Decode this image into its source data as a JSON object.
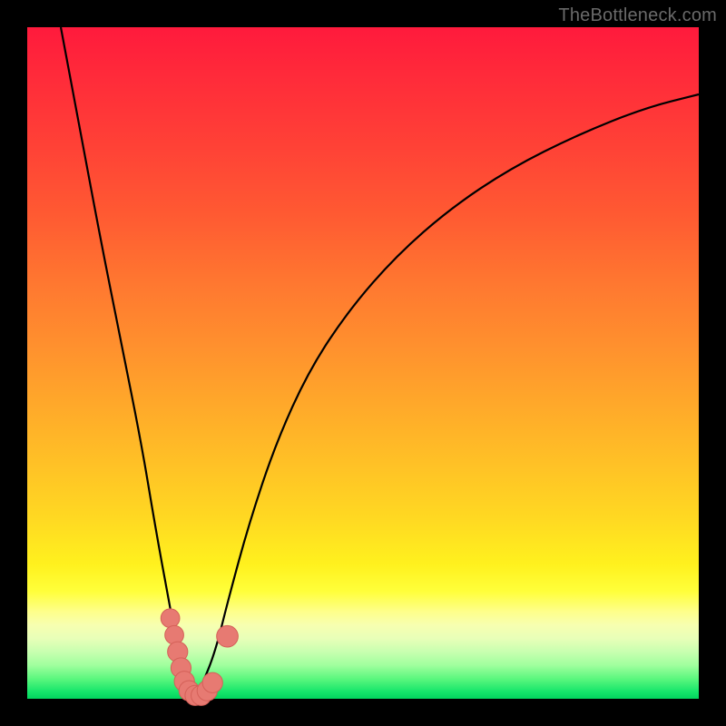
{
  "watermark": "TheBottleneck.com",
  "chart_data": {
    "type": "line",
    "title": "",
    "xlabel": "",
    "ylabel": "",
    "xlim": [
      0,
      100
    ],
    "ylim": [
      0,
      100
    ],
    "grid": false,
    "legend": false,
    "series": [
      {
        "name": "bottleneck-curve",
        "x": [
          5,
          8,
          11,
          14,
          17,
          19,
          21,
          22.5,
          24,
          25,
          26,
          28,
          30,
          33,
          37,
          42,
          48,
          55,
          63,
          72,
          82,
          92,
          100
        ],
        "y": [
          100,
          84,
          68,
          53,
          38,
          26,
          15,
          7,
          2,
          0,
          2,
          7,
          15,
          26,
          38,
          49,
          58,
          66,
          73,
          79,
          84,
          88,
          90
        ]
      }
    ],
    "markers": [
      {
        "x": 21.3,
        "y": 12.0,
        "r": 1.4
      },
      {
        "x": 21.9,
        "y": 9.5,
        "r": 1.4
      },
      {
        "x": 22.4,
        "y": 7.0,
        "r": 1.5
      },
      {
        "x": 22.9,
        "y": 4.6,
        "r": 1.5
      },
      {
        "x": 23.4,
        "y": 2.6,
        "r": 1.5
      },
      {
        "x": 24.1,
        "y": 1.2,
        "r": 1.5
      },
      {
        "x": 25.0,
        "y": 0.5,
        "r": 1.5
      },
      {
        "x": 25.9,
        "y": 0.5,
        "r": 1.5
      },
      {
        "x": 26.8,
        "y": 1.2,
        "r": 1.5
      },
      {
        "x": 27.6,
        "y": 2.4,
        "r": 1.5
      },
      {
        "x": 29.8,
        "y": 9.3,
        "r": 1.6
      }
    ],
    "colors": {
      "curve": "#000000",
      "marker_fill": "#e77a72",
      "marker_stroke": "#d46058"
    }
  }
}
